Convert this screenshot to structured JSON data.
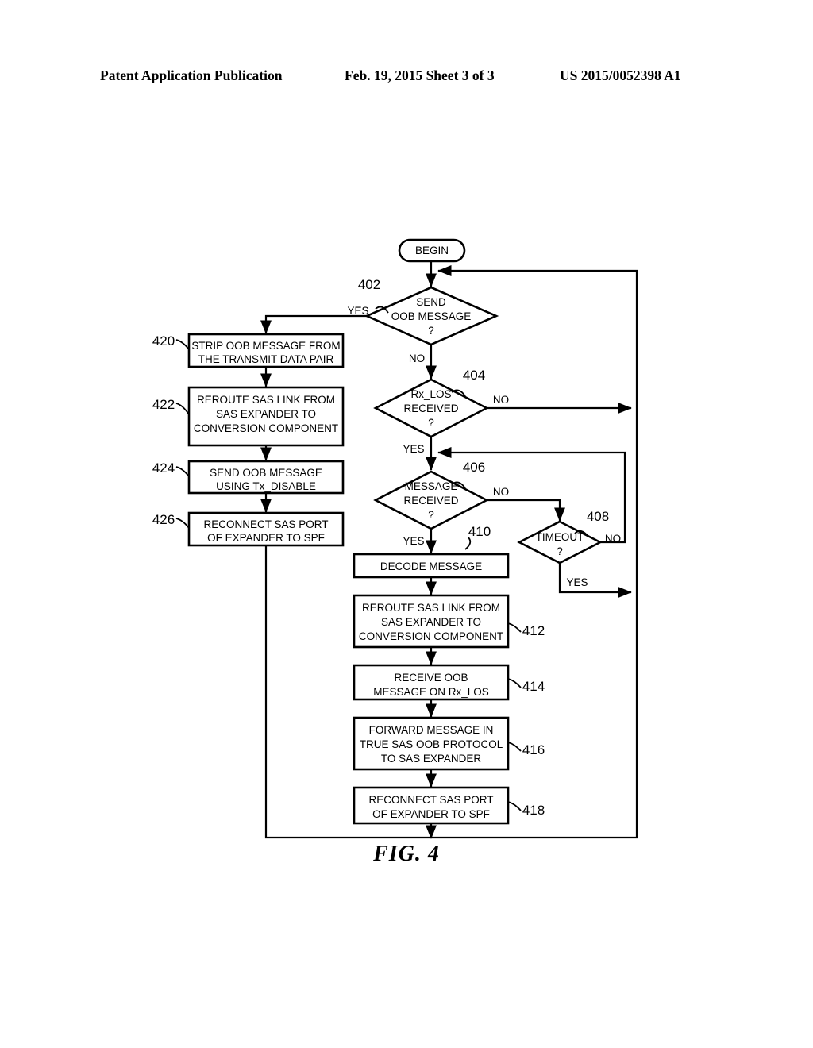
{
  "header": {
    "title": "Patent Application Publication",
    "date_sheet": "Feb. 19, 2015  Sheet 3 of 3",
    "publication_number": "US 2015/0052398 A1"
  },
  "figure": {
    "caption": "FIG. 4"
  },
  "flowchart": {
    "terminator": {
      "label": "BEGIN"
    },
    "decisions": [
      {
        "ref": "402",
        "line1": "SEND",
        "line2": "OOB MESSAGE",
        "line3": "?",
        "yes": "YES",
        "no": "NO"
      },
      {
        "ref": "404",
        "line1": "Rx_LOS",
        "line2": "RECEIVED",
        "line3": "?",
        "yes": "YES",
        "no": "NO"
      },
      {
        "ref": "406",
        "line1": "MESSAGE",
        "line2": "RECEIVED",
        "line3": "?",
        "yes": "YES",
        "no": "NO"
      },
      {
        "ref": "408",
        "line1": "TIMEOUT",
        "line2": "?",
        "line3": "",
        "yes": "YES",
        "no": "NO"
      }
    ],
    "left_branch": [
      {
        "ref": "420",
        "lines": [
          "STRIP OOB MESSAGE FROM",
          "THE TRANSMIT DATA PAIR"
        ]
      },
      {
        "ref": "422",
        "lines": [
          "REROUTE SAS LINK FROM",
          "SAS EXPANDER TO",
          "CONVERSION COMPONENT"
        ]
      },
      {
        "ref": "424",
        "lines": [
          "SEND OOB MESSAGE",
          "USING Tx_DISABLE"
        ]
      },
      {
        "ref": "426",
        "lines": [
          "RECONNECT SAS PORT",
          "OF EXPANDER TO SPF"
        ]
      }
    ],
    "main_branch": [
      {
        "ref": "410",
        "lines": [
          "DECODE MESSAGE"
        ]
      },
      {
        "ref": "412",
        "lines": [
          "REROUTE SAS LINK FROM",
          "SAS EXPANDER TO",
          "CONVERSION COMPONENT"
        ]
      },
      {
        "ref": "414",
        "lines": [
          "RECEIVE OOB",
          "MESSAGE ON Rx_LOS"
        ]
      },
      {
        "ref": "416",
        "lines": [
          "FORWARD MESSAGE IN",
          "TRUE SAS OOB PROTOCOL",
          "TO SAS EXPANDER"
        ]
      },
      {
        "ref": "418",
        "lines": [
          "RECONNECT SAS PORT",
          "OF EXPANDER TO SPF"
        ]
      }
    ],
    "colors": {
      "ink": "#000000",
      "paper": "#ffffff"
    }
  }
}
